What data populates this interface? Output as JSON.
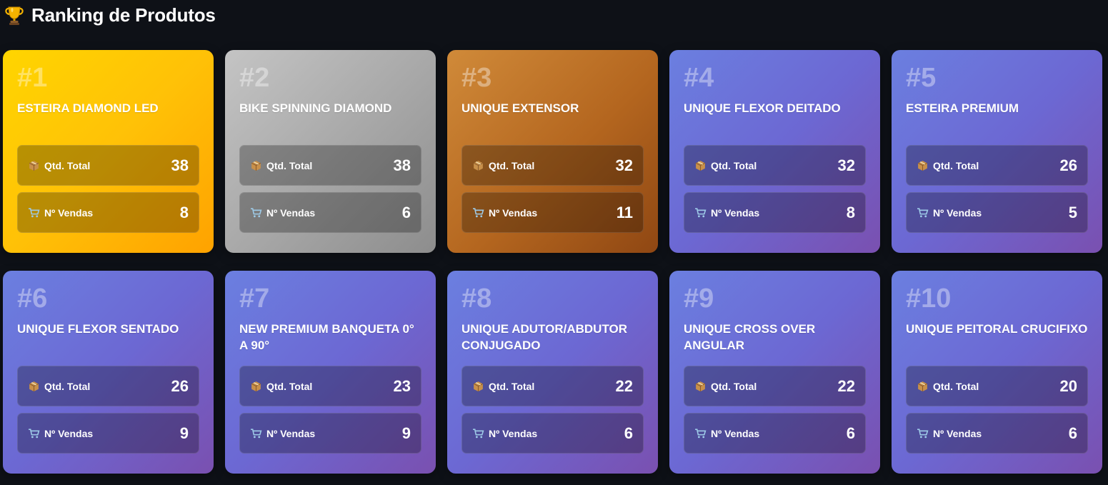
{
  "header": {
    "title": "Ranking de Produtos",
    "icon": "trophy-icon"
  },
  "labels": {
    "qty": "Qtd. Total",
    "sales": "Nº Vendas"
  },
  "colors": {
    "background": "#0e1117",
    "gold": "#ffc107",
    "silver": "#a9a9a9",
    "bronze": "#b4661f",
    "purple": "#6c68d3"
  },
  "products": [
    {
      "rank": "#1",
      "name": "ESTEIRA DIAMOND LED",
      "qty": "38",
      "sales": "8",
      "tier": "gold"
    },
    {
      "rank": "#2",
      "name": "BIKE SPINNING DIAMOND",
      "qty": "38",
      "sales": "6",
      "tier": "silver"
    },
    {
      "rank": "#3",
      "name": "UNIQUE EXTENSOR",
      "qty": "32",
      "sales": "11",
      "tier": "bronze"
    },
    {
      "rank": "#4",
      "name": "UNIQUE FLEXOR DEITADO",
      "qty": "32",
      "sales": "8",
      "tier": "purple"
    },
    {
      "rank": "#5",
      "name": "ESTEIRA PREMIUM",
      "qty": "26",
      "sales": "5",
      "tier": "purple"
    },
    {
      "rank": "#6",
      "name": "UNIQUE FLEXOR SENTADO",
      "qty": "26",
      "sales": "9",
      "tier": "purple"
    },
    {
      "rank": "#7",
      "name": "NEW PREMIUM BANQUETA 0° A 90°",
      "qty": "23",
      "sales": "9",
      "tier": "purple"
    },
    {
      "rank": "#8",
      "name": "UNIQUE ADUTOR/ABDUTOR CONJUGADO",
      "qty": "22",
      "sales": "6",
      "tier": "purple"
    },
    {
      "rank": "#9",
      "name": "UNIQUE CROSS OVER ANGULAR",
      "qty": "22",
      "sales": "6",
      "tier": "purple"
    },
    {
      "rank": "#10",
      "name": "UNIQUE PEITORAL CRUCIFIXO",
      "qty": "20",
      "sales": "6",
      "tier": "purple"
    }
  ]
}
